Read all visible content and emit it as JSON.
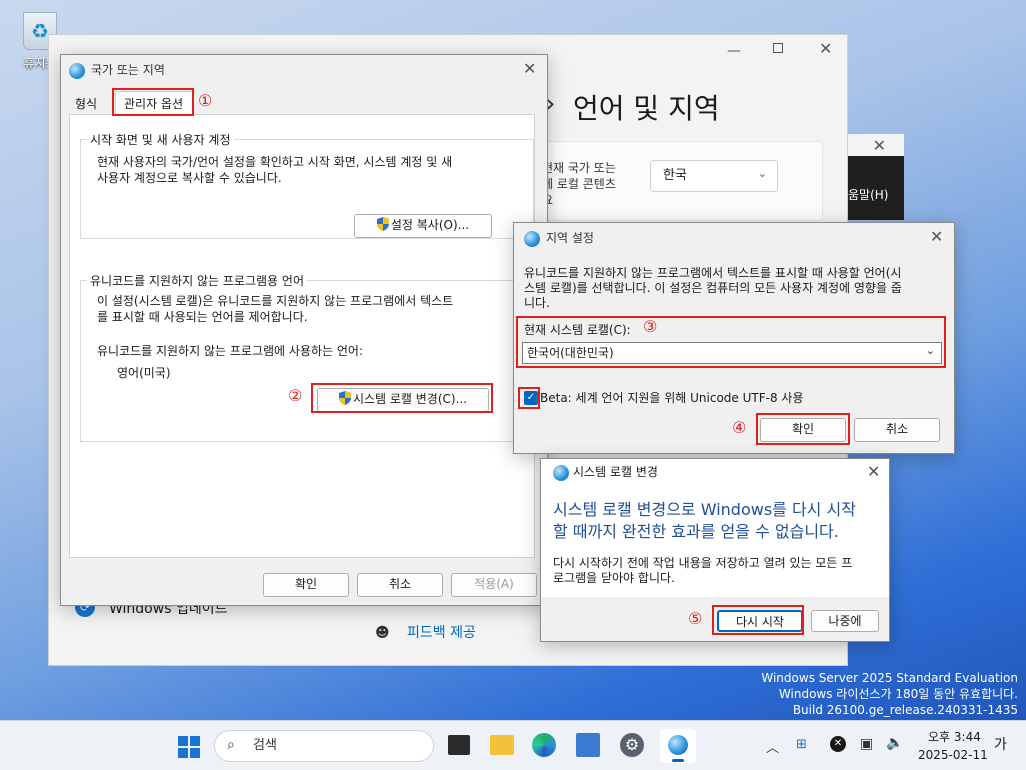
{
  "desktop": {
    "recycle_label": "휴지통",
    "watermark": [
      "Windows Server 2025 Standard Evaluation",
      "Windows 라이선스가 180일 동안 유효합니다.",
      "Build 26100.ge_release.240331-1435"
    ]
  },
  "settings_window": {
    "title": "언어 및 지역",
    "chevron": "›",
    "side_text": [
      "현재 국가 또는",
      "에 로컬 콘텐츠",
      "요"
    ],
    "country_value": "한국",
    "update_label": "Windows 업데이트",
    "feedback_label": "피드백 제공"
  },
  "behind_window": {
    "menu_text": "움말(H)"
  },
  "region_dialog": {
    "title": "국가 또는 지역",
    "tabs": [
      "형식",
      "관리자 옵션"
    ],
    "group1_title": "시작 화면 및 새 사용자 계정",
    "group1_desc": [
      "현재 사용자의 국가/언어 설정을 확인하고 시작 화면, 시스템 계정 및 새",
      "사용자 계정으로 복사할 수 있습니다."
    ],
    "copy_button": "설정 복사(O)...",
    "group2_title": "유니코드를 지원하지 않는 프로그램용 언어",
    "group2_desc": [
      "이 설정(시스템 로캘)은 유니코드를 지원하지 않는 프로그램에서 텍스트",
      "를 표시할 때 사용되는 언어를 제어합니다."
    ],
    "current_lang_label": "유니코드를 지원하지 않는 프로그램에 사용하는 언어:",
    "current_lang_value": "영어(미국)",
    "change_locale_button": "시스템 로캘 변경(C)...",
    "ok": "확인",
    "cancel": "취소",
    "apply": "적용(A)"
  },
  "locale_dialog": {
    "title": "지역 설정",
    "desc": [
      "유니코드를 지원하지 않는 프로그램에서 텍스트를 표시할 때 사용할 언어(시",
      "스템 로캘)를 선택합니다. 이 설정은 컴퓨터의 모든 사용자 계정에 영향을 줍",
      "니다."
    ],
    "current_label": "현재 시스템 로캘(C):",
    "current_value": "한국어(대한민국)",
    "beta_label": "Beta: 세계 언어 지원을 위해 Unicode UTF-8 사용",
    "ok": "확인",
    "cancel": "취소"
  },
  "restart_dialog": {
    "title": "시스템 로캘 변경",
    "headline": [
      "시스템 로캘 변경으로 Windows를 다시 시작",
      "할 때까지 완전한 효과를 얻을 수 없습니다."
    ],
    "desc": [
      "다시 시작하기 전에 작업 내용을 저장하고 열려 있는 모든 프",
      "로그램을 닫아야 합니다."
    ],
    "restart": "다시 시작",
    "later": "나중에"
  },
  "annotations": [
    "①",
    "②",
    "③",
    "④",
    "⑤"
  ],
  "taskbar": {
    "search_placeholder": "검색",
    "time": "오후 3:44",
    "date": "2025-02-11",
    "lang_indicator": "가"
  },
  "colors": {
    "accent": "#0067c0",
    "annotation_red": "#e0201c",
    "headline_blue": "#1e4e9c"
  }
}
